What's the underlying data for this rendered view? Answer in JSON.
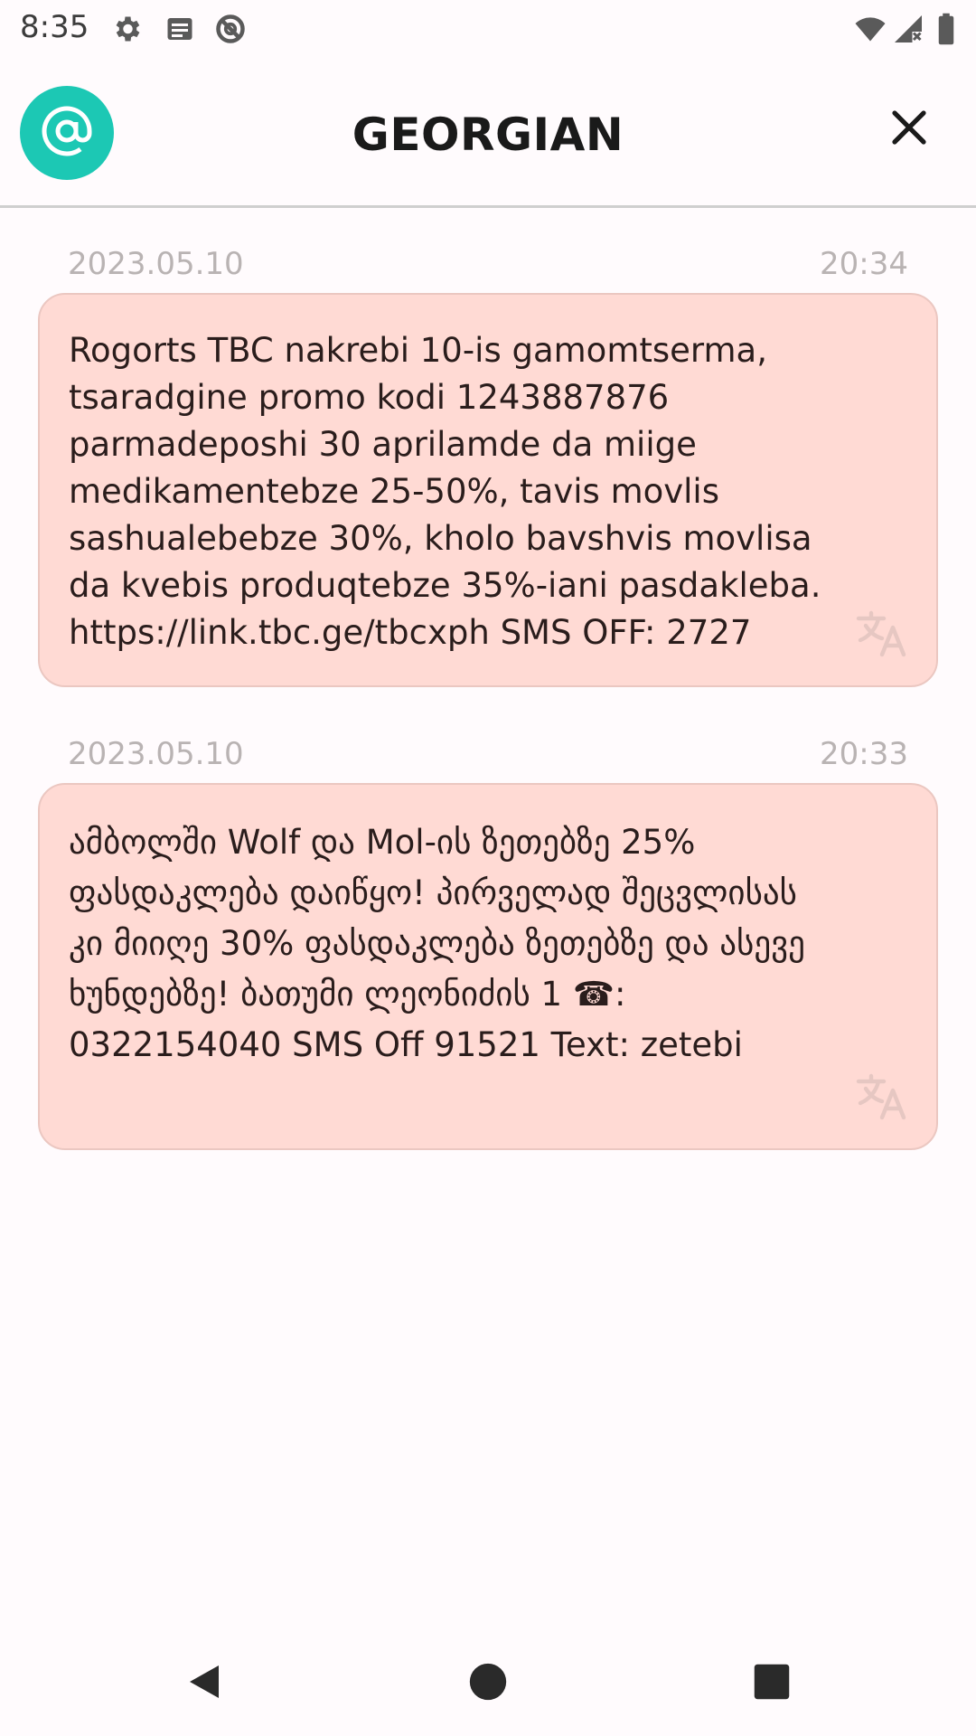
{
  "status_bar": {
    "time": "8:35",
    "left_icons": [
      "settings-icon",
      "notification-icon",
      "blocked-icon"
    ],
    "right_icons": [
      "wifi-icon",
      "signal-icon",
      "battery-icon"
    ]
  },
  "header": {
    "title": "GEORGIAN",
    "avatar_icon": "at-sign-icon",
    "avatar_color": "#1cc8b4",
    "close_icon": "close-icon"
  },
  "messages": [
    {
      "date": "2023.05.10",
      "time": "20:34",
      "text": "Rogorts TBC nakrebi 10-is gamomtserma, tsaradgine promo kodi 1243887876 parmadeposhi 30 aprilamde da miige medikamentebze 25-50%, tavis movlis sashualebebze 30%, kholo bavshvis movlisa da kvebis produqtebze 35%-iani pasdakleba. https://link.tbc.ge/tbcxph SMS OFF: 2727",
      "icon": "translate-icon"
    },
    {
      "date": "2023.05.10",
      "time": "20:33",
      "text": "ამბოლში Wolf და Mol-ის ზეთებზე 25% ფასდაკლება დაიწყო! პირველად შეცვლისას კი მიიღე 30% ფასდაკლება ზეთებზე და ასევე ხუნდებზე! ბათუმი ლეონიძის 1 ☎: 0322154040 SMS Off 91521 Text: zetebi",
      "icon": "translate-icon"
    }
  ],
  "colors": {
    "bubble_bg": "#ffdad4",
    "bubble_border": "#ebc7c1",
    "meta_text": "#b9b3b3",
    "page_bg": "#fffbfd"
  },
  "nav_bar": {
    "icons": [
      "back-icon",
      "home-icon",
      "recents-icon"
    ]
  }
}
